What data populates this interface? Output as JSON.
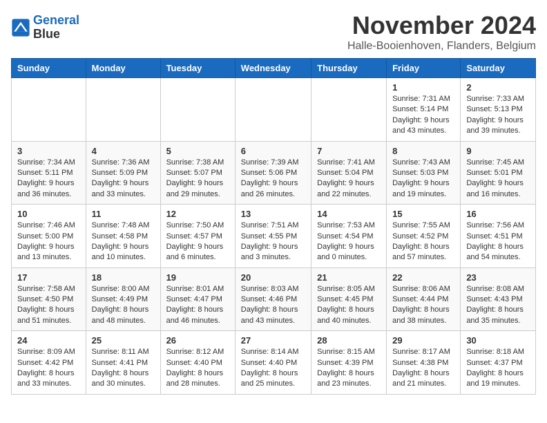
{
  "logo": {
    "line1": "General",
    "line2": "Blue"
  },
  "title": "November 2024",
  "location": "Halle-Booienhoven, Flanders, Belgium",
  "headers": [
    "Sunday",
    "Monday",
    "Tuesday",
    "Wednesday",
    "Thursday",
    "Friday",
    "Saturday"
  ],
  "weeks": [
    [
      {
        "day": "",
        "info": ""
      },
      {
        "day": "",
        "info": ""
      },
      {
        "day": "",
        "info": ""
      },
      {
        "day": "",
        "info": ""
      },
      {
        "day": "",
        "info": ""
      },
      {
        "day": "1",
        "info": "Sunrise: 7:31 AM\nSunset: 5:14 PM\nDaylight: 9 hours\nand 43 minutes."
      },
      {
        "day": "2",
        "info": "Sunrise: 7:33 AM\nSunset: 5:13 PM\nDaylight: 9 hours\nand 39 minutes."
      }
    ],
    [
      {
        "day": "3",
        "info": "Sunrise: 7:34 AM\nSunset: 5:11 PM\nDaylight: 9 hours\nand 36 minutes."
      },
      {
        "day": "4",
        "info": "Sunrise: 7:36 AM\nSunset: 5:09 PM\nDaylight: 9 hours\nand 33 minutes."
      },
      {
        "day": "5",
        "info": "Sunrise: 7:38 AM\nSunset: 5:07 PM\nDaylight: 9 hours\nand 29 minutes."
      },
      {
        "day": "6",
        "info": "Sunrise: 7:39 AM\nSunset: 5:06 PM\nDaylight: 9 hours\nand 26 minutes."
      },
      {
        "day": "7",
        "info": "Sunrise: 7:41 AM\nSunset: 5:04 PM\nDaylight: 9 hours\nand 22 minutes."
      },
      {
        "day": "8",
        "info": "Sunrise: 7:43 AM\nSunset: 5:03 PM\nDaylight: 9 hours\nand 19 minutes."
      },
      {
        "day": "9",
        "info": "Sunrise: 7:45 AM\nSunset: 5:01 PM\nDaylight: 9 hours\nand 16 minutes."
      }
    ],
    [
      {
        "day": "10",
        "info": "Sunrise: 7:46 AM\nSunset: 5:00 PM\nDaylight: 9 hours\nand 13 minutes."
      },
      {
        "day": "11",
        "info": "Sunrise: 7:48 AM\nSunset: 4:58 PM\nDaylight: 9 hours\nand 10 minutes."
      },
      {
        "day": "12",
        "info": "Sunrise: 7:50 AM\nSunset: 4:57 PM\nDaylight: 9 hours\nand 6 minutes."
      },
      {
        "day": "13",
        "info": "Sunrise: 7:51 AM\nSunset: 4:55 PM\nDaylight: 9 hours\nand 3 minutes."
      },
      {
        "day": "14",
        "info": "Sunrise: 7:53 AM\nSunset: 4:54 PM\nDaylight: 9 hours\nand 0 minutes."
      },
      {
        "day": "15",
        "info": "Sunrise: 7:55 AM\nSunset: 4:52 PM\nDaylight: 8 hours\nand 57 minutes."
      },
      {
        "day": "16",
        "info": "Sunrise: 7:56 AM\nSunset: 4:51 PM\nDaylight: 8 hours\nand 54 minutes."
      }
    ],
    [
      {
        "day": "17",
        "info": "Sunrise: 7:58 AM\nSunset: 4:50 PM\nDaylight: 8 hours\nand 51 minutes."
      },
      {
        "day": "18",
        "info": "Sunrise: 8:00 AM\nSunset: 4:49 PM\nDaylight: 8 hours\nand 48 minutes."
      },
      {
        "day": "19",
        "info": "Sunrise: 8:01 AM\nSunset: 4:47 PM\nDaylight: 8 hours\nand 46 minutes."
      },
      {
        "day": "20",
        "info": "Sunrise: 8:03 AM\nSunset: 4:46 PM\nDaylight: 8 hours\nand 43 minutes."
      },
      {
        "day": "21",
        "info": "Sunrise: 8:05 AM\nSunset: 4:45 PM\nDaylight: 8 hours\nand 40 minutes."
      },
      {
        "day": "22",
        "info": "Sunrise: 8:06 AM\nSunset: 4:44 PM\nDaylight: 8 hours\nand 38 minutes."
      },
      {
        "day": "23",
        "info": "Sunrise: 8:08 AM\nSunset: 4:43 PM\nDaylight: 8 hours\nand 35 minutes."
      }
    ],
    [
      {
        "day": "24",
        "info": "Sunrise: 8:09 AM\nSunset: 4:42 PM\nDaylight: 8 hours\nand 33 minutes."
      },
      {
        "day": "25",
        "info": "Sunrise: 8:11 AM\nSunset: 4:41 PM\nDaylight: 8 hours\nand 30 minutes."
      },
      {
        "day": "26",
        "info": "Sunrise: 8:12 AM\nSunset: 4:40 PM\nDaylight: 8 hours\nand 28 minutes."
      },
      {
        "day": "27",
        "info": "Sunrise: 8:14 AM\nSunset: 4:40 PM\nDaylight: 8 hours\nand 25 minutes."
      },
      {
        "day": "28",
        "info": "Sunrise: 8:15 AM\nSunset: 4:39 PM\nDaylight: 8 hours\nand 23 minutes."
      },
      {
        "day": "29",
        "info": "Sunrise: 8:17 AM\nSunset: 4:38 PM\nDaylight: 8 hours\nand 21 minutes."
      },
      {
        "day": "30",
        "info": "Sunrise: 8:18 AM\nSunset: 4:37 PM\nDaylight: 8 hours\nand 19 minutes."
      }
    ]
  ]
}
